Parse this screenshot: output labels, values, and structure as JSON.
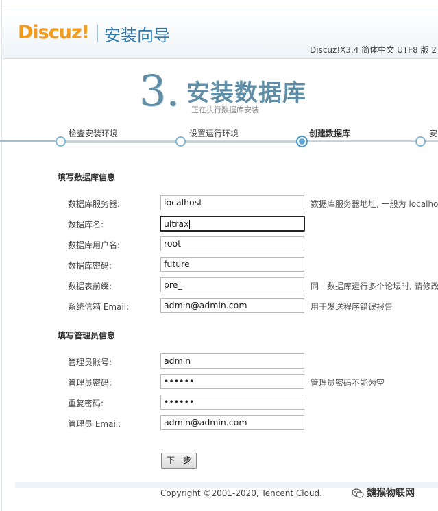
{
  "header": {
    "logo": "Discuz!",
    "wizard_title": "安装向导",
    "version": "Discuz!X3.4 简体中文 UTF8 版 2"
  },
  "step": {
    "number": "3.",
    "title": "安装数据库",
    "subtitle": "正在执行数据库安装",
    "progress_steps": [
      {
        "label": "检查安装环境",
        "state": "done"
      },
      {
        "label": "设置运行环境",
        "state": "done"
      },
      {
        "label": "创建数据库",
        "state": "active"
      },
      {
        "label": "安",
        "state": "pending"
      }
    ]
  },
  "db_section": {
    "title": "填写数据库信息",
    "fields": [
      {
        "label": "数据库服务器:",
        "value": "localhost",
        "hint": "数据库服务器地址, 一般为 localhost"
      },
      {
        "label": "数据库名:",
        "value": "ultrax",
        "hint": ""
      },
      {
        "label": "数据库用户名:",
        "value": "root",
        "hint": ""
      },
      {
        "label": "数据库密码:",
        "value": "future",
        "hint": ""
      },
      {
        "label": "数据表前缀:",
        "value": "pre_",
        "hint": "同一数据库运行多个论坛时, 请修改"
      },
      {
        "label": "系统信箱 Email:",
        "value": "admin@admin.com",
        "hint": "用于发送程序错误报告"
      }
    ]
  },
  "admin_section": {
    "title": "填写管理员信息",
    "fields": [
      {
        "label": "管理员账号:",
        "value": "admin",
        "hint": ""
      },
      {
        "label": "管理员密码:",
        "value": "••••••",
        "hint": "管理员密码不能为空"
      },
      {
        "label": "重复密码:",
        "value": "••••••",
        "hint": ""
      },
      {
        "label": "管理员 Email:",
        "value": "admin@admin.com",
        "hint": ""
      }
    ]
  },
  "actions": {
    "next_label": "下一步"
  },
  "footer": {
    "copyright": "Copyright ©2001-2020, Tencent Cloud.",
    "watermark": "魏猴物联网"
  },
  "colors": {
    "logo_orange": "#f29b1d",
    "title_blue": "#2e7ab0",
    "step_blue_gray": "#5f8ea6",
    "active_dot": "#5aa7d8"
  }
}
